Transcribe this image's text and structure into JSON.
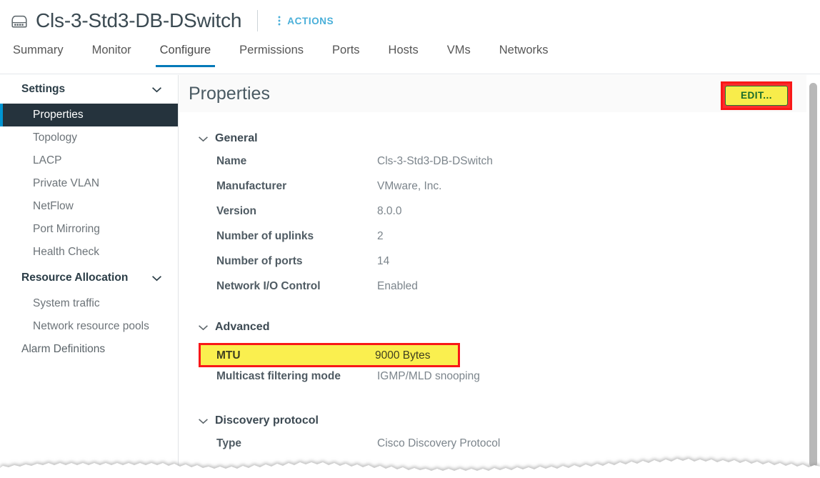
{
  "header": {
    "icon": "distributed-switch-icon",
    "title": "Cls-3-Std3-DB-DSwitch",
    "actions_label": "ACTIONS",
    "actions_icon": "kebab-menu-icon",
    "accent_color": "#49afd9"
  },
  "tabs": [
    {
      "label": "Summary",
      "active": false
    },
    {
      "label": "Monitor",
      "active": false
    },
    {
      "label": "Configure",
      "active": true
    },
    {
      "label": "Permissions",
      "active": false
    },
    {
      "label": "Ports",
      "active": false
    },
    {
      "label": "Hosts",
      "active": false
    },
    {
      "label": "VMs",
      "active": false
    },
    {
      "label": "Networks",
      "active": false
    }
  ],
  "tab_active_underline_color": "#0079b8",
  "sidebar": {
    "groups": [
      {
        "label": "Settings",
        "chevron": "chevron-down-icon",
        "items": [
          {
            "label": "Properties",
            "selected": true
          },
          {
            "label": "Topology",
            "selected": false
          },
          {
            "label": "LACP",
            "selected": false
          },
          {
            "label": "Private VLAN",
            "selected": false
          },
          {
            "label": "NetFlow",
            "selected": false
          },
          {
            "label": "Port Mirroring",
            "selected": false
          },
          {
            "label": "Health Check",
            "selected": false
          }
        ]
      },
      {
        "label": "Resource Allocation",
        "chevron": "chevron-down-icon",
        "items": [
          {
            "label": "System traffic",
            "selected": false
          },
          {
            "label": "Network resource pools",
            "selected": false
          }
        ]
      }
    ],
    "standalone_items": [
      {
        "label": "Alarm Definitions",
        "selected": false
      }
    ],
    "selected_bg_color": "#25333d",
    "selected_accent_color": "#0095d3"
  },
  "content": {
    "title": "Properties",
    "edit_button": {
      "label": "EDIT...",
      "fill_color": "#f8ec4b",
      "text_color": "#176b2b",
      "highlight_border_color": "#f81818"
    },
    "sections": [
      {
        "title": "General",
        "chevron": "chevron-down-icon",
        "rows": [
          {
            "label": "Name",
            "value": "Cls-3-Std3-DB-DSwitch",
            "highlight": false
          },
          {
            "label": "Manufacturer",
            "value": "VMware, Inc.",
            "highlight": false
          },
          {
            "label": "Version",
            "value": "8.0.0",
            "highlight": false
          },
          {
            "label": "Number of uplinks",
            "value": "2",
            "highlight": false
          },
          {
            "label": "Number of ports",
            "value": "14",
            "highlight": false
          },
          {
            "label": "Network I/O Control",
            "value": "Enabled",
            "highlight": false
          }
        ]
      },
      {
        "title": "Advanced",
        "chevron": "chevron-down-icon",
        "rows": [
          {
            "label": "MTU",
            "value": "9000 Bytes",
            "highlight": true
          },
          {
            "label": "Multicast filtering mode",
            "value": "IGMP/MLD snooping",
            "highlight": false
          }
        ]
      },
      {
        "title": "Discovery protocol",
        "chevron": "chevron-down-icon",
        "rows": [
          {
            "label": "Type",
            "value": "Cisco Discovery Protocol",
            "highlight": false
          }
        ]
      }
    ],
    "highlight_fill_color": "#faef4f",
    "highlight_border_color": "#f81818"
  },
  "scrollbar": {
    "name": "vertical-scrollbar",
    "thumb_color": "#b8b8b8"
  }
}
